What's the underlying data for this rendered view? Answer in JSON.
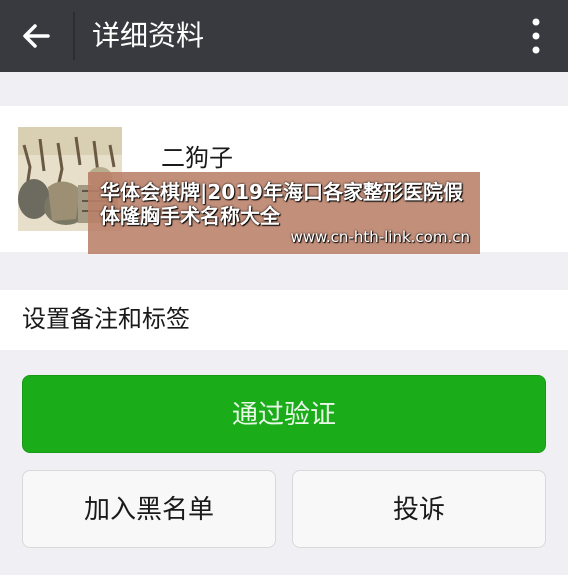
{
  "header": {
    "title": "详细资料"
  },
  "profile": {
    "name": "二狗子"
  },
  "overlay": {
    "title": "华体会棋牌|2019年海口各家整形医院假体隆胸手术名称大全",
    "url": "www.cn-hth-link.com.cn"
  },
  "remark": {
    "label": "设置备注和标签"
  },
  "buttons": {
    "verify": "通过验证",
    "blacklist": "加入黑名单",
    "report": "投诉"
  },
  "colors": {
    "topbar": "#393a3f",
    "accent_green": "#1aad19",
    "background": "#efeff4"
  }
}
